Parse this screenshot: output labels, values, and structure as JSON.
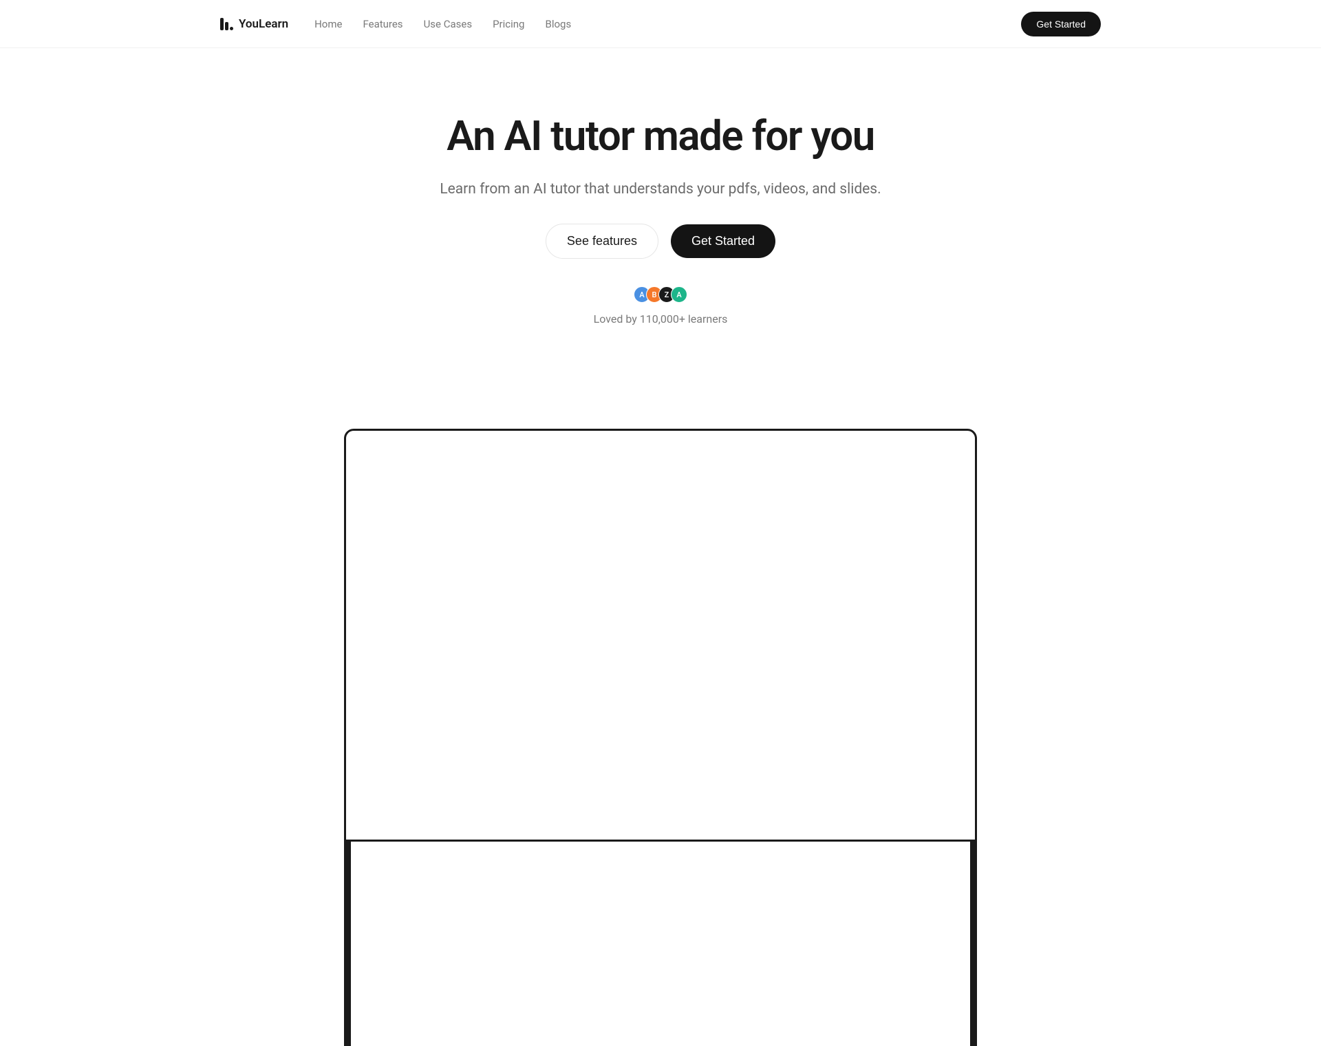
{
  "brand": {
    "name": "YouLearn"
  },
  "nav": {
    "links": [
      "Home",
      "Features",
      "Use Cases",
      "Pricing",
      "Blogs"
    ],
    "cta": "Get Started"
  },
  "hero": {
    "title": "An AI tutor made for you",
    "subtitle": "Learn from an AI tutor that understands your pdfs, videos, and slides.",
    "secondary_cta": "See features",
    "primary_cta": "Get Started"
  },
  "social_proof": {
    "avatars": [
      {
        "initial": "A",
        "color": "#4a90e2"
      },
      {
        "initial": "B",
        "color": "#f5782a"
      },
      {
        "initial": "Z",
        "color": "#1a1a1a"
      },
      {
        "initial": "A",
        "color": "#1db58a"
      }
    ],
    "text": "Loved by 110,000+ learners"
  }
}
